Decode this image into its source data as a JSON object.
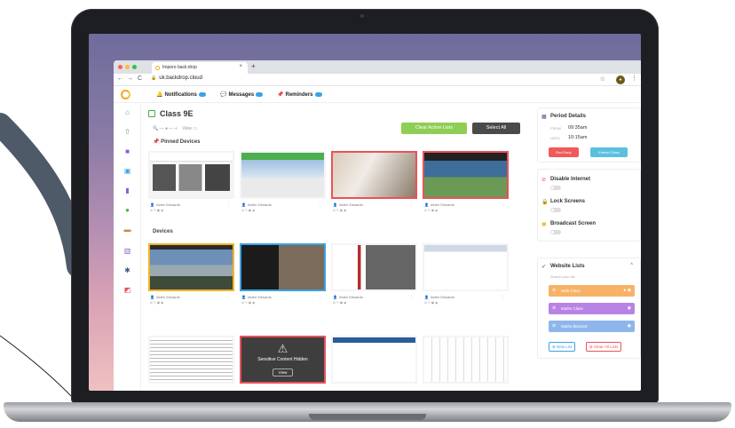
{
  "browser": {
    "tab_title": "Impero back:drop",
    "tab_close": "×",
    "new_tab": "+",
    "url": "uk.backdrop.cloud",
    "back": "←",
    "forward": "→",
    "reload": "C",
    "star": "☆",
    "kebab": "⋮"
  },
  "topnav": {
    "notifications": "Notifications",
    "messages": "Messages",
    "reminders": "Reminders"
  },
  "main": {
    "class_title": "Class 9E",
    "zoom_label": "View",
    "clear_active_lists": "Clear Active Lists",
    "select_all": "Select All",
    "pinned_heading": "Pinned Devices",
    "devices_heading": "Devices",
    "sensitive_text": "Sensitive Content Hidden",
    "sensitive_button": "View"
  },
  "cards": [
    {
      "owner": "Aiden Edwards",
      "border": "",
      "type": "article"
    },
    {
      "owner": "Aiden Edwards",
      "border": "",
      "type": "travel"
    },
    {
      "owner": "Aiden Edwards",
      "border": "#e9525a",
      "type": "dog"
    },
    {
      "owner": "Aiden Edwards",
      "border": "#e9525a",
      "type": "landscape"
    },
    {
      "owner": "Aiden Edwards",
      "border": "#f0b429",
      "type": "mountain"
    },
    {
      "owner": "Aiden Edwards",
      "border": "#3aa3e3",
      "type": "food"
    },
    {
      "owner": "Aiden Edwards",
      "border": "",
      "type": "news"
    },
    {
      "owner": "Aiden Edwards",
      "border": "",
      "type": "doc"
    },
    {
      "owner": "",
      "border": "",
      "type": "text"
    },
    {
      "owner": "",
      "border": "#e9525a",
      "type": "sensitive"
    },
    {
      "owner": "",
      "border": "",
      "type": "web"
    },
    {
      "owner": "",
      "border": "",
      "type": "sheet"
    }
  ],
  "period": {
    "heading": "Period Details",
    "from_label": "FROM",
    "from_time": "09:35am",
    "until_label": "UNTIL",
    "until_time": "10:15am",
    "end_early": "End Early",
    "extend_class": "Extend Class"
  },
  "controls": {
    "disable_internet": "Disable Internet",
    "lock_screens": "Lock Screens",
    "broadcast_screen": "Broadcast Screen"
  },
  "website_lists": {
    "heading": "Website Lists",
    "search_placeholder": "Search your list",
    "items": [
      {
        "label": "Safe Class",
        "color": "#f7b267"
      },
      {
        "label": "Maths Class",
        "color": "#b983e5"
      },
      {
        "label": "Maths Blocked",
        "color": "#8fb6ec"
      }
    ],
    "new_list": "New List",
    "clear_all_lists": "Clear All Lists"
  },
  "colors": {
    "accent_green": "#8fce55",
    "accent_red": "#f05a5a",
    "accent_blue": "#5bc0de"
  }
}
